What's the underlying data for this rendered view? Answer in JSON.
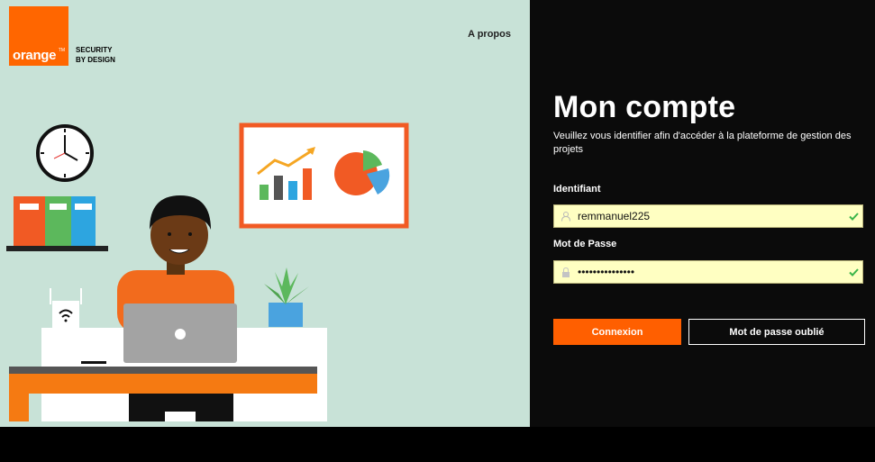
{
  "brand": {
    "logo_text": "orange",
    "logo_tm": "TM",
    "tagline_line1": "SECURITY",
    "tagline_line2": "BY DESIGN",
    "color": "#ff6600"
  },
  "nav": {
    "about_link": "A propos"
  },
  "login": {
    "title": "Mon compte",
    "subtitle": "Veuillez vous identifier afin d'accéder à la plateforme de gestion des projets",
    "username": {
      "label": "Identifiant",
      "value": "remmanuel225",
      "icon": "user-icon",
      "valid": true
    },
    "password": {
      "label": "Mot de Passe",
      "value": "•••••••••••••••",
      "icon": "lock-icon",
      "valid": true
    },
    "submit_label": "Connexion",
    "forgot_label": "Mot de passe oublié"
  },
  "colors": {
    "accent": "#ff6600",
    "illustration_bg": "#c8e2d7",
    "panel_bg": "#0b0b0b",
    "field_bg": "#ffffc2",
    "valid_check": "#3bb54a"
  }
}
